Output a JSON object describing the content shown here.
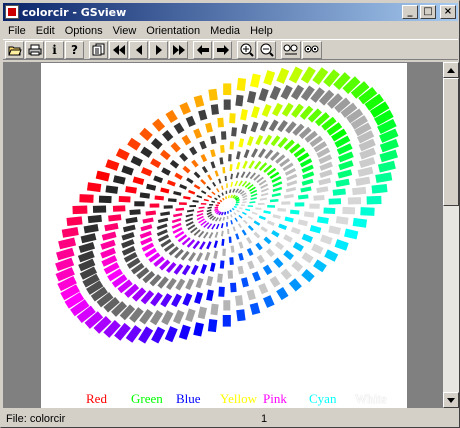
{
  "window": {
    "title": "colorcir - GSview",
    "minimize": "_",
    "maximize": "□",
    "close": "×"
  },
  "menu": [
    "File",
    "Edit",
    "Options",
    "View",
    "Orientation",
    "Media",
    "Help"
  ],
  "toolbar": {
    "buttons": [
      "open-icon",
      "print-icon",
      "info-icon",
      "help-icon",
      "goto-page-icon",
      "first-page-icon",
      "previous-page-icon",
      "next-page-icon",
      "last-page-icon",
      "back-icon",
      "forward-icon",
      "zoom-in-icon",
      "zoom-out-icon",
      "magnify-text-icon",
      "magnify-icon"
    ],
    "info_glyph": "i",
    "help_glyph": "?"
  },
  "document": {
    "legend": [
      {
        "label": "Red",
        "color": "#ff0000"
      },
      {
        "label": "Green",
        "color": "#00ff00"
      },
      {
        "label": "Blue",
        "color": "#0000ff"
      },
      {
        "label": "Yellow",
        "color": "#ffff00"
      },
      {
        "label": "Pink",
        "color": "#ff00ff"
      },
      {
        "label": "Cyan",
        "color": "#00ffff"
      },
      {
        "label": "White",
        "color": "#ffffff"
      }
    ]
  },
  "status": {
    "file": "File: colorcir",
    "page": "1"
  }
}
